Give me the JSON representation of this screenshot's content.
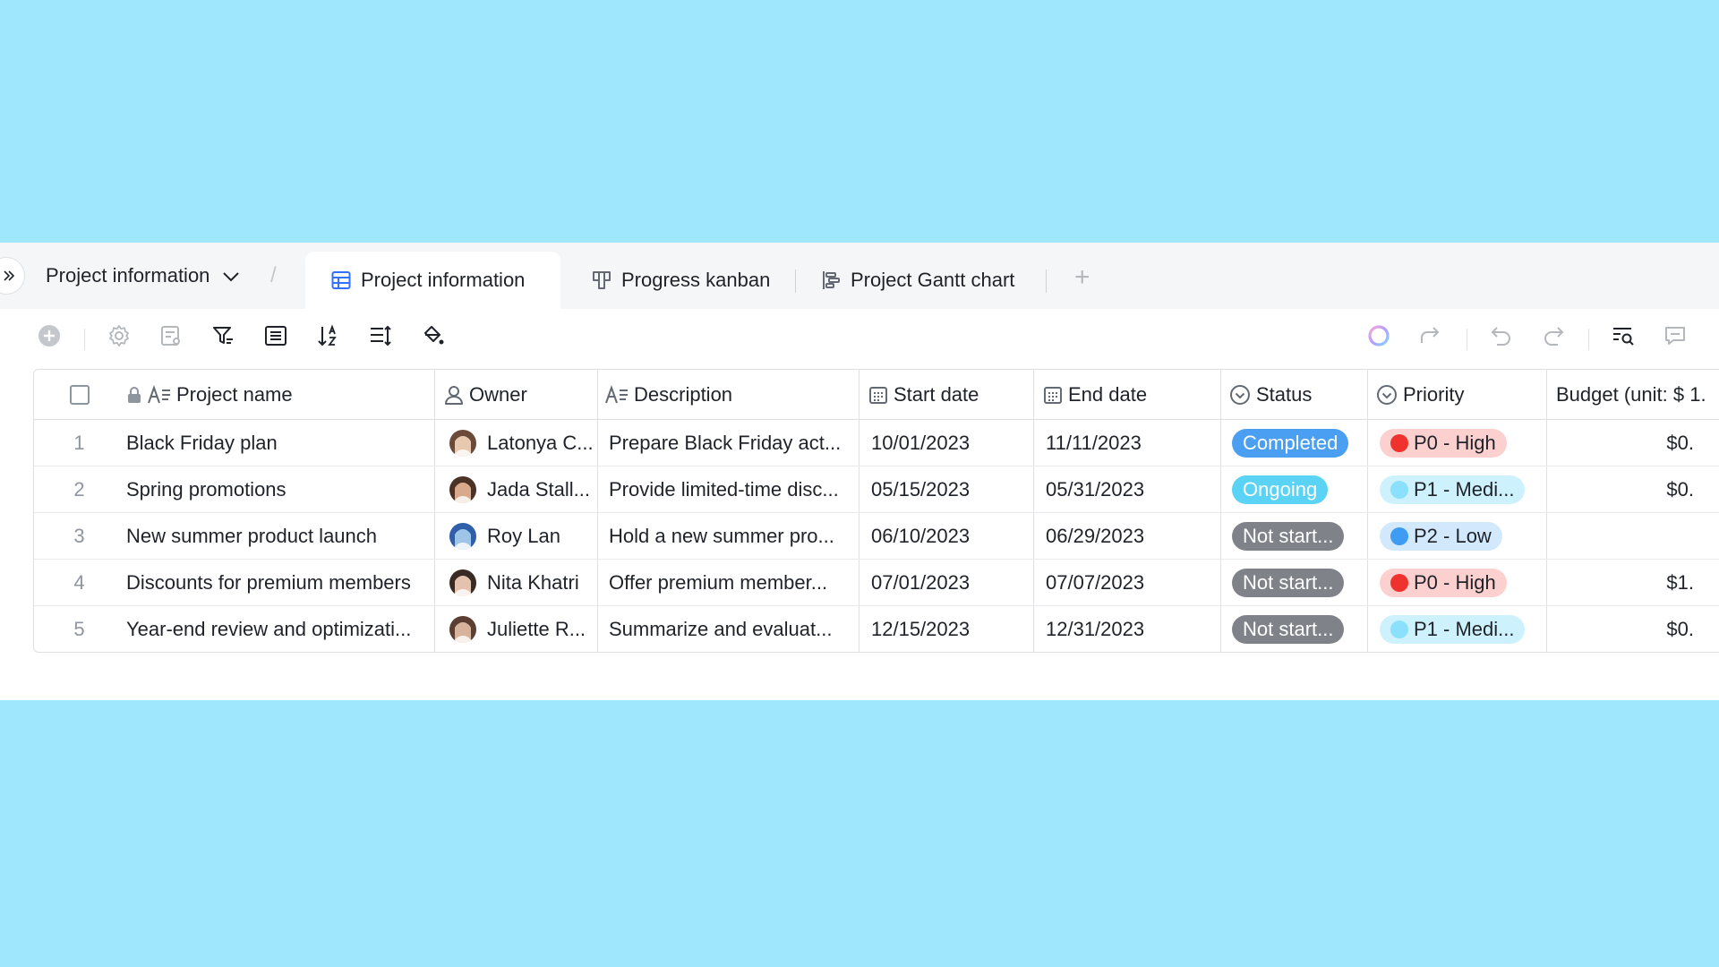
{
  "tabbar": {
    "breadcrumb": "Project information",
    "slash": "/",
    "tabs": [
      {
        "label": "Project information",
        "icon": "grid-view-icon"
      },
      {
        "label": "Progress kanban",
        "icon": "kanban-icon"
      },
      {
        "label": "Project Gantt chart",
        "icon": "gantt-icon"
      }
    ],
    "add": "+"
  },
  "table": {
    "headers": {
      "project_name": "Project name",
      "owner": "Owner",
      "description": "Description",
      "start_date": "Start date",
      "end_date": "End date",
      "status": "Status",
      "priority": "Priority",
      "budget": "Budget (unit: $ 1."
    },
    "rows": [
      {
        "num": "1",
        "name": "Black Friday plan",
        "owner": "Latonya C...",
        "description": "Prepare Black Friday act...",
        "start": "10/01/2023",
        "end": "11/11/2023",
        "status": "Completed",
        "priority": "P0 - High",
        "budget": "$0."
      },
      {
        "num": "2",
        "name": "Spring promotions",
        "owner": "Jada Stall...",
        "description": "Provide limited-time disc...",
        "start": "05/15/2023",
        "end": "05/31/2023",
        "status": "Ongoing",
        "priority": "P1 - Medi...",
        "budget": "$0."
      },
      {
        "num": "3",
        "name": "New summer product launch",
        "owner": "Roy Lan",
        "description": "Hold a new summer pro...",
        "start": "06/10/2023",
        "end": "06/29/2023",
        "status": "Not start...",
        "priority": "P2 - Low",
        "budget": ""
      },
      {
        "num": "4",
        "name": "Discounts for premium members",
        "owner": "Nita Khatri",
        "description": "Offer premium member...",
        "start": "07/01/2023",
        "end": "07/07/2023",
        "status": "Not start...",
        "priority": "P0 - High",
        "budget": "$1."
      },
      {
        "num": "5",
        "name": "Year-end review and optimizati...",
        "owner": "Juliette R...",
        "description": "Summarize and evaluat...",
        "start": "12/15/2023",
        "end": "12/31/2023",
        "status": "Not start...",
        "priority": "P1 - Medi...",
        "budget": "$0."
      }
    ]
  },
  "colors": {
    "background": "#9fe7fd",
    "status_completed": "#4a9ff2",
    "status_ongoing": "#5ad3f5",
    "status_not_started": "#7f8389",
    "prio_high_bg": "#fbd0cf",
    "prio_high_dot": "#f0322f",
    "prio_medium_bg": "#cdf2fd",
    "prio_medium_dot": "#8be0fb",
    "prio_low_bg": "#d2e9fd",
    "prio_low_dot": "#3e9cf2"
  }
}
